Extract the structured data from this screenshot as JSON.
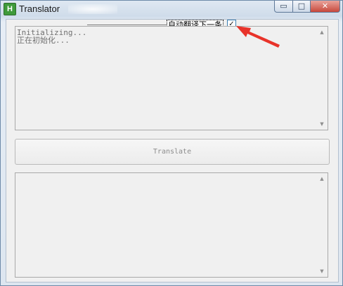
{
  "window": {
    "app_icon_letter": "H",
    "title": "Translator",
    "buttons": {
      "minimize": "▭",
      "maximize": "□",
      "close": "✕"
    }
  },
  "options": {
    "auto_translate_label": "自动翻译下一条",
    "auto_translate_checked": "✓"
  },
  "source_box": {
    "lines": "Initializing...\n正在初始化..."
  },
  "translate_button": {
    "label": "Translate"
  },
  "output_box": {
    "lines": ""
  },
  "scrollbar": {
    "up": "▲",
    "down": "▼"
  },
  "annotation": {
    "arrow_color": "#e8332a"
  }
}
